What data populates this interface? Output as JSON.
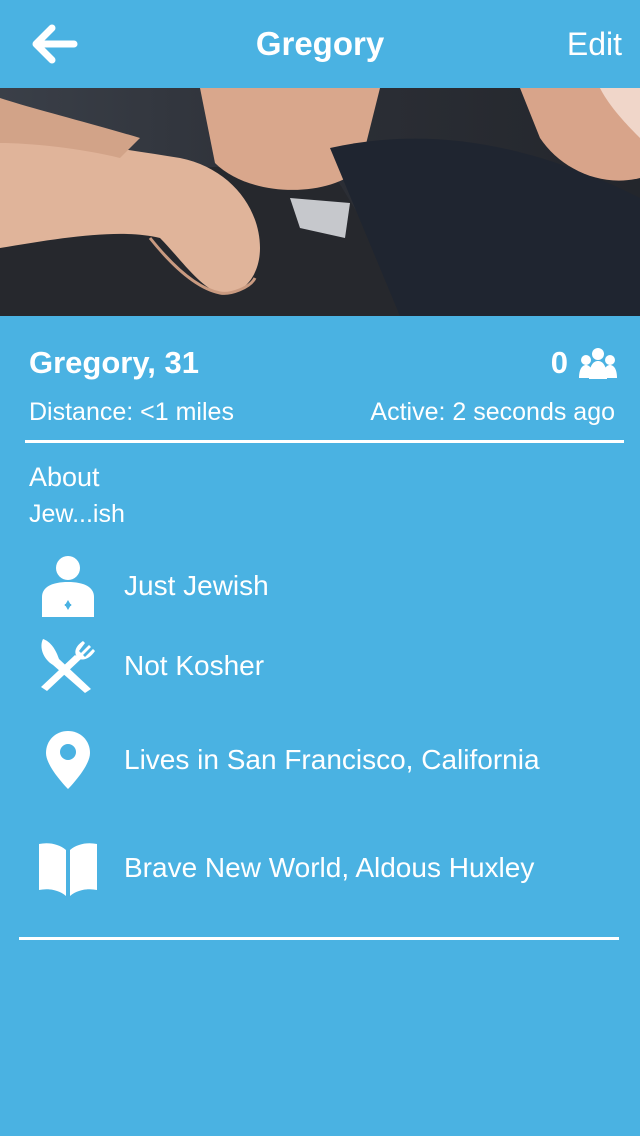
{
  "nav": {
    "title": "Gregory",
    "edit_label": "Edit"
  },
  "profile": {
    "name_age": "Gregory, 31",
    "friend_count": "0",
    "distance": "Distance: <1 miles",
    "active": "Active: 2 seconds ago"
  },
  "about": {
    "heading": "About",
    "text": "Jew...ish"
  },
  "details": [
    {
      "icon": "person-star-of-david-icon",
      "label": "Just Jewish"
    },
    {
      "icon": "fork-knife-icon",
      "label": "Not Kosher"
    },
    {
      "icon": "location-pin-icon",
      "label": "Lives in San Francisco, California"
    },
    {
      "icon": "open-book-icon",
      "label": "Brave New World, Aldous Huxley"
    }
  ],
  "colors": {
    "background": "#4ab2e2",
    "text": "#ffffff"
  }
}
